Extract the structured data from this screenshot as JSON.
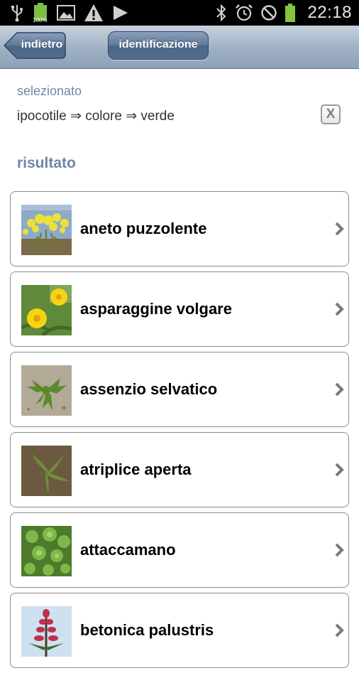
{
  "status_bar": {
    "time": "22:18",
    "battery_label": "100%",
    "left_icons": [
      "usb-icon",
      "battery-full-icon",
      "image-icon",
      "warning-icon",
      "play-icon"
    ],
    "right_icons": [
      "bluetooth-icon",
      "alarm-icon",
      "no-signal-icon",
      "battery-icon"
    ]
  },
  "toolbar": {
    "back_label": "indietro",
    "identify_label": "identificazione"
  },
  "selection": {
    "label": "selezionato",
    "path": "ipocotile ⇒ colore ⇒ verde",
    "clear_label": "X"
  },
  "results": {
    "label": "risultato",
    "items": [
      {
        "label": "aneto puzzolente",
        "thumb": "yellow-umbel-flowers"
      },
      {
        "label": "asparaggine volgare",
        "thumb": "yellow-daisy-flowers"
      },
      {
        "label": "assenzio selvatico",
        "thumb": "green-seedling-on-soil"
      },
      {
        "label": "atriplice aperta",
        "thumb": "green-leaves-on-soil"
      },
      {
        "label": "attaccamano",
        "thumb": "green-leafy-plant"
      },
      {
        "label": "betonica palustris",
        "thumb": "red-flower-spike"
      }
    ]
  },
  "colors": {
    "accent": "#6d87a7",
    "toolbar_top": "#c7d2de",
    "toolbar_bottom": "#8ea1b8",
    "button": "#536d8e"
  }
}
